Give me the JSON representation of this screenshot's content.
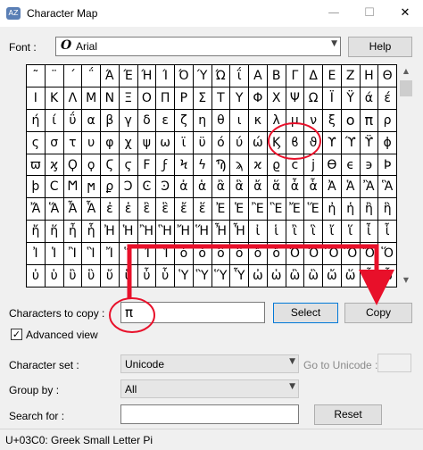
{
  "window": {
    "title": "Character Map",
    "icon_name": "character-map-icon",
    "minimize_glyph": "—",
    "maximize_glyph": "☐",
    "close_glyph": "✕"
  },
  "font": {
    "label": "Font :",
    "selected": "Arial",
    "font_icon_glyph": "O",
    "help_label": "Help"
  },
  "char_grid": {
    "rows": [
      [
        "˜",
        "¨",
        "΄",
        "΅",
        "Ά",
        "Έ",
        "Ή",
        "Ί",
        "Ό",
        "Ύ",
        "Ώ",
        "ΐ",
        "Α",
        "Β",
        "Γ",
        "Δ",
        "Ε",
        "Ζ",
        "Η",
        "Θ"
      ],
      [
        "Ι",
        "Κ",
        "Λ",
        "Μ",
        "Ν",
        "Ξ",
        "Ο",
        "Π",
        "Ρ",
        "Σ",
        "Τ",
        "Υ",
        "Φ",
        "Χ",
        "Ψ",
        "Ω",
        "Ϊ",
        "Ϋ",
        "ά",
        "έ"
      ],
      [
        "ή",
        "ί",
        "ΰ",
        "α",
        "β",
        "γ",
        "δ",
        "ε",
        "ζ",
        "η",
        "θ",
        "ι",
        "κ",
        "λ",
        "μ",
        "ν",
        "ξ",
        "ο",
        "π",
        "ρ"
      ],
      [
        "ς",
        "σ",
        "τ",
        "υ",
        "φ",
        "χ",
        "ψ",
        "ω",
        "ϊ",
        "ϋ",
        "ό",
        "ύ",
        "ώ",
        "Ϗ",
        "ϐ",
        "ϑ",
        "ϒ",
        "ϓ",
        "ϔ",
        "ϕ"
      ],
      [
        "ϖ",
        "ϗ",
        "Ϙ",
        "ϙ",
        "Ϛ",
        "ϛ",
        "Ϝ",
        "ϝ",
        "Ϟ",
        "ϟ",
        "Ϡ",
        "ϡ",
        "ϰ",
        "ϱ",
        "ϲ",
        "ϳ",
        "ϴ",
        "ϵ",
        "϶",
        "Ϸ"
      ],
      [
        "ϸ",
        "Ϲ",
        "Ϻ",
        "ϻ",
        "ϼ",
        "Ͻ",
        "Ͼ",
        "Ͽ",
        "ἀ",
        "ἁ",
        "ἂ",
        "ἃ",
        "ἄ",
        "ἅ",
        "ἆ",
        "ἇ",
        "Ἀ",
        "Ἁ",
        "Ἂ",
        "Ἃ"
      ],
      [
        "Ἄ",
        "Ἅ",
        "Ἆ",
        "Ἇ",
        "ἐ",
        "ἑ",
        "ἒ",
        "ἓ",
        "ἔ",
        "ἕ",
        "Ἐ",
        "Ἑ",
        "Ἒ",
        "Ἓ",
        "Ἔ",
        "Ἕ",
        "ἠ",
        "ἡ",
        "ἢ",
        "ἣ"
      ],
      [
        "ἤ",
        "ἥ",
        "ἦ",
        "ἧ",
        "Ἠ",
        "Ἡ",
        "Ἢ",
        "Ἣ",
        "Ἤ",
        "Ἥ",
        "Ἦ",
        "Ἧ",
        "ἰ",
        "ἱ",
        "ἲ",
        "ἳ",
        "ἴ",
        "ἵ",
        "ἶ",
        "ἷ"
      ],
      [
        "Ἰ",
        "Ἱ",
        "Ἲ",
        "Ἳ",
        "Ἴ",
        "Ἵ",
        "Ἶ",
        "Ἷ",
        "ὀ",
        "ὁ",
        "ὂ",
        "ὃ",
        "ὄ",
        "ὅ",
        "Ὀ",
        "Ὁ",
        "Ὂ",
        "Ὃ",
        "Ὄ",
        "Ὅ"
      ],
      [
        "ὐ",
        "ὑ",
        "ὒ",
        "ὓ",
        "ὔ",
        "ὕ",
        "ὖ",
        "ὗ",
        "Ὑ",
        "Ὓ",
        "Ὕ",
        "Ὗ",
        "ὠ",
        "ὡ",
        "ὢ",
        "ὣ",
        "ὤ",
        "ὥ",
        "ὦ",
        "ὧ"
      ]
    ],
    "highlighted": {
      "row": 2,
      "cols": [
        17,
        18
      ]
    }
  },
  "copy_row": {
    "label": "Characters to copy :",
    "value": "π",
    "select_label": "Select",
    "copy_label": "Copy"
  },
  "advanced_view": {
    "label": "Advanced view",
    "checked": true,
    "check_glyph": "✓"
  },
  "character_set": {
    "label": "Character set :",
    "selected": "Unicode",
    "goto_label": "Go to Unicode :",
    "goto_value": ""
  },
  "group_by": {
    "label": "Group by :",
    "selected": "All"
  },
  "search": {
    "label": "Search for :",
    "value": "",
    "reset_label": "Reset"
  },
  "status": {
    "text": "U+03C0: Greek Small Letter Pi"
  },
  "annotation": {
    "color": "#e8102a"
  },
  "icons": {
    "dropdown_arrow": "▼",
    "scroll_up": "▲",
    "scroll_down": "▼"
  }
}
